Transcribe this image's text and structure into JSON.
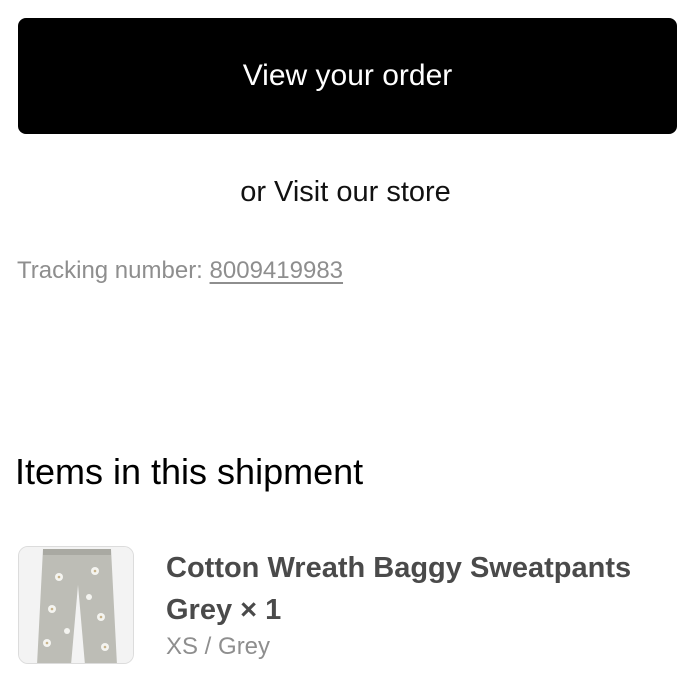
{
  "actions": {
    "view_order_label": "View your order",
    "visit_prefix": "or",
    "visit_store_label": "Visit our store"
  },
  "tracking": {
    "label": "Tracking number:",
    "number": "8009419983"
  },
  "shipment": {
    "heading": "Items in this shipment",
    "items": [
      {
        "title": "Cotton Wreath Baggy Sweatpants",
        "color_line": "Grey",
        "quantity": "× 1",
        "variant": "XS / Grey",
        "image_icon": "sweatpants-thumbnail"
      }
    ]
  },
  "colors": {
    "button_bg": "#000000",
    "button_text": "#ffffff",
    "muted_text": "#8e8e8e",
    "item_title_text": "#4a4a4a"
  }
}
